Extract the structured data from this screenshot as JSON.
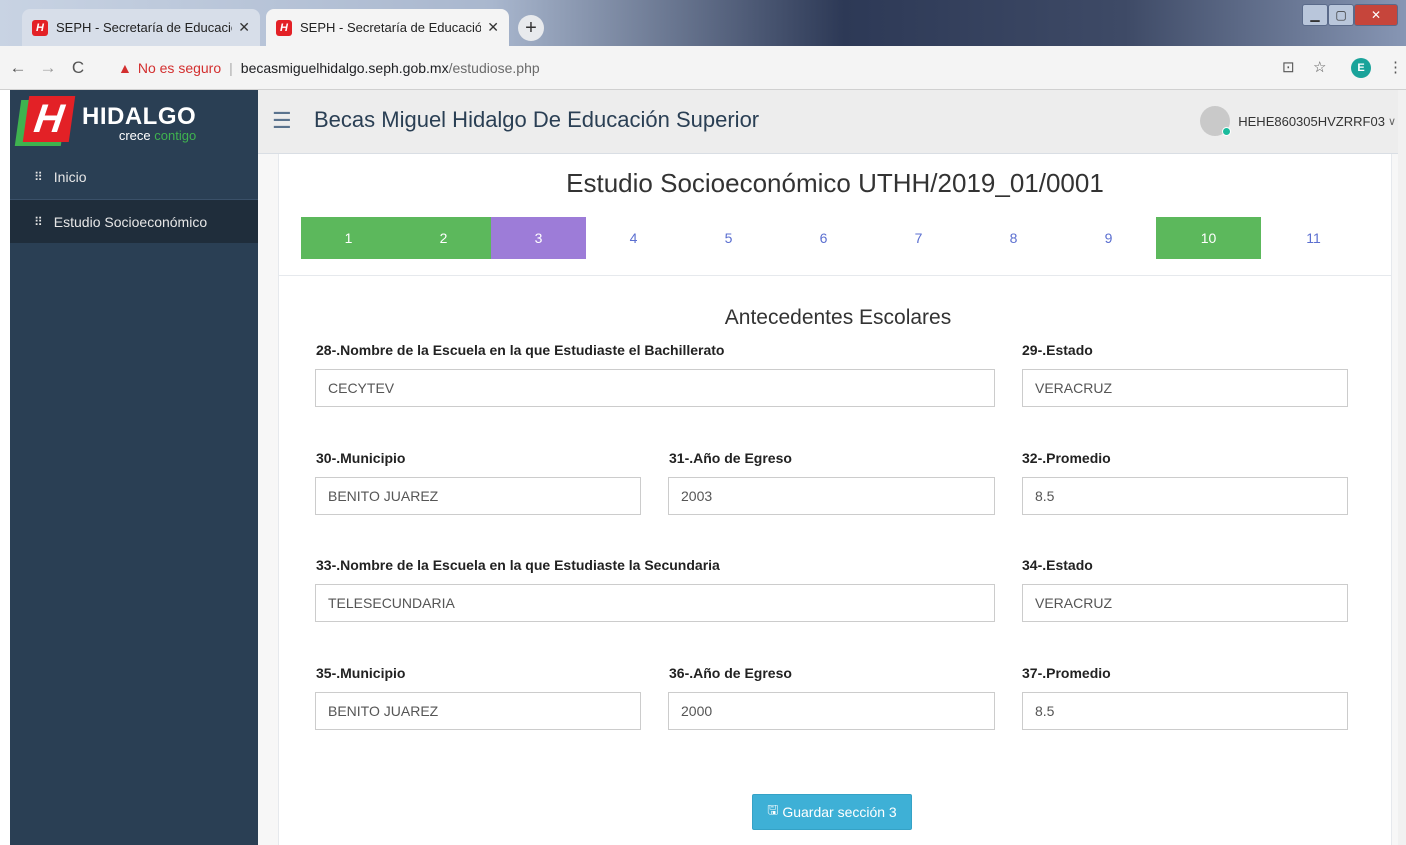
{
  "browser": {
    "tabs": [
      {
        "title": "SEPH - Secretaría de Educación P",
        "active": false
      },
      {
        "title": "SEPH - Secretaría de Educación P",
        "active": true
      }
    ],
    "new_tab_label": "+",
    "security_label": "No es seguro",
    "url_host": "becasmiguelhidalgo.seph.gob.mx",
    "url_path": "/estudiose.php",
    "profile_initial": "E"
  },
  "brand": {
    "name": "HIDALGO",
    "sub_a": "crece",
    "sub_b": "contigo",
    "logo_letter": "H"
  },
  "sidebar": {
    "items": [
      {
        "label": "Inicio"
      },
      {
        "label": "Estudio Socioeconómico"
      }
    ]
  },
  "header": {
    "title": "Becas Miguel Hidalgo De Educación Superior",
    "user": "HEHE860305HVZRRF03"
  },
  "panel": {
    "title": "Estudio Socioeconómico UTHH/2019_01/0001",
    "steps": [
      "1",
      "2",
      "3",
      "4",
      "5",
      "6",
      "7",
      "8",
      "9",
      "10",
      "11"
    ],
    "section_title": "Antecedentes Escolares"
  },
  "form": {
    "q28": {
      "label": "28-.Nombre de la Escuela en la que Estudiaste el Bachillerato",
      "value": "CECYTEV"
    },
    "q29": {
      "label": "29-.Estado",
      "value": "VERACRUZ"
    },
    "q30": {
      "label": "30-.Municipio",
      "value": "BENITO JUAREZ"
    },
    "q31": {
      "label": "31-.Año de Egreso",
      "value": "2003"
    },
    "q32": {
      "label": "32-.Promedio",
      "value": "8.5"
    },
    "q33": {
      "label": "33-.Nombre de la Escuela en la que Estudiaste la Secundaria",
      "value": "TELESECUNDARIA"
    },
    "q34": {
      "label": "34-.Estado",
      "value": "VERACRUZ"
    },
    "q35": {
      "label": "35-.Municipio",
      "value": "BENITO JUAREZ"
    },
    "q36": {
      "label": "36-.Año de Egreso",
      "value": "2000"
    },
    "q37": {
      "label": "37-.Promedio",
      "value": "8.5"
    }
  },
  "save_button": {
    "label": "Guardar sección 3"
  },
  "colors": {
    "sidebar": "#2a3f54",
    "step_done": "#5cb85c",
    "step_current": "#9d7cd8",
    "button": "#3eb0d6"
  }
}
